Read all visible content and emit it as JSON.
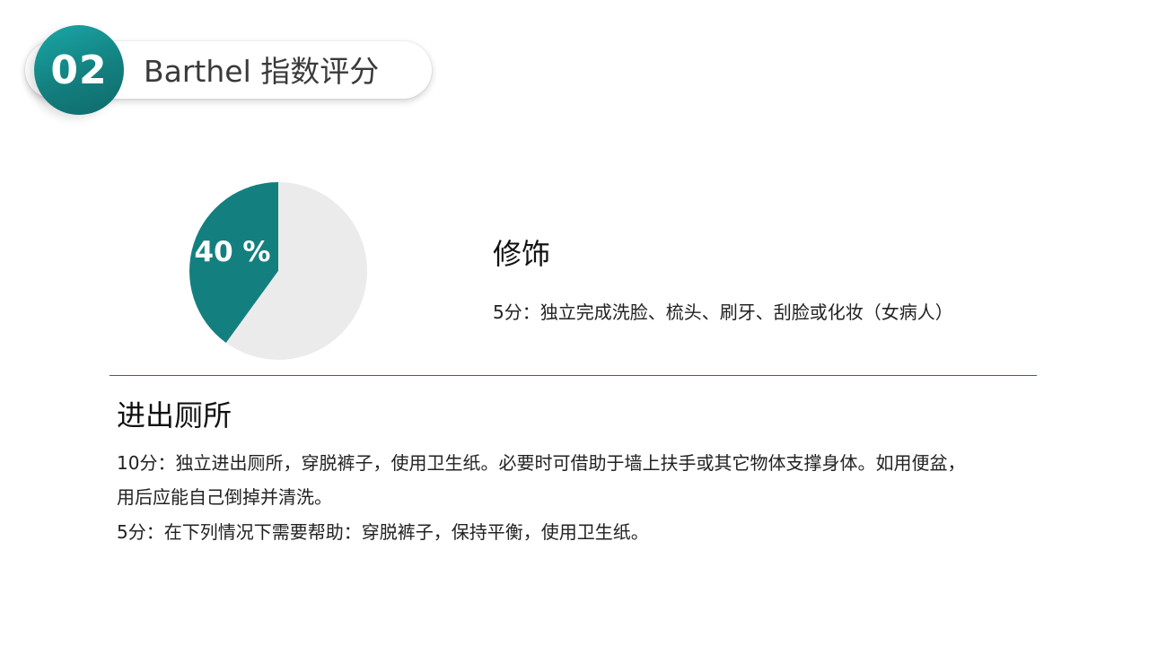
{
  "header": {
    "number": "02",
    "title": "Barthel 指数评分"
  },
  "colors": {
    "accent": "#13807f",
    "pie_remainder": "#ebebeb",
    "divider": "#1a6f79"
  },
  "chart_data": {
    "type": "pie",
    "values": [
      40,
      60
    ],
    "colors": [
      "#13807f",
      "#ebebeb"
    ],
    "data_label": "40 %"
  },
  "grooming": {
    "heading": "修饰",
    "lines": [
      "5分：独立完成洗脸、梳头、刷牙、刮脸或化妆（女病人）"
    ]
  },
  "toilet": {
    "heading": "进出厕所",
    "lines": [
      "10分：独立进出厕所，穿脱裤子，使用卫生纸。必要时可借助于墙上扶手或其它物体支撑身体。如用便盆，",
      "用后应能自己倒掉并清洗。",
      "5分：在下列情况下需要帮助：穿脱裤子，保持平衡，使用卫生纸。"
    ]
  }
}
